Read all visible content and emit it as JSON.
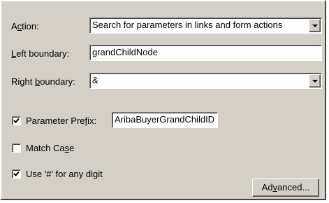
{
  "action": {
    "label_pre": "A",
    "label_ul": "c",
    "label_post": "tion:",
    "value": "Search for parameters in links and form actions"
  },
  "left_boundary": {
    "label_ul": "L",
    "label_post": "eft boundary:",
    "value": "grandChildNode"
  },
  "right_boundary": {
    "label_pre": "Right ",
    "label_ul": "b",
    "label_post": "oundary:",
    "value": "&"
  },
  "parameter_prefix": {
    "checked": true,
    "label_pre": "Parameter Pre",
    "label_ul": "f",
    "label_post": "ix:",
    "value": "AribaBuyerGrandChildID"
  },
  "match_case": {
    "checked": false,
    "label_pre": "Match Ca",
    "label_ul": "s",
    "label_post": "e"
  },
  "use_hash": {
    "checked": true,
    "label_pre": "Use '#' for any di",
    "label_ul": "g",
    "label_post": "it"
  },
  "advanced_button": {
    "label_pre": "Ad",
    "label_ul": "v",
    "label_post": "anced..."
  },
  "icons": {
    "dropdown": "chevron-down-icon",
    "check": "checkmark-icon"
  }
}
